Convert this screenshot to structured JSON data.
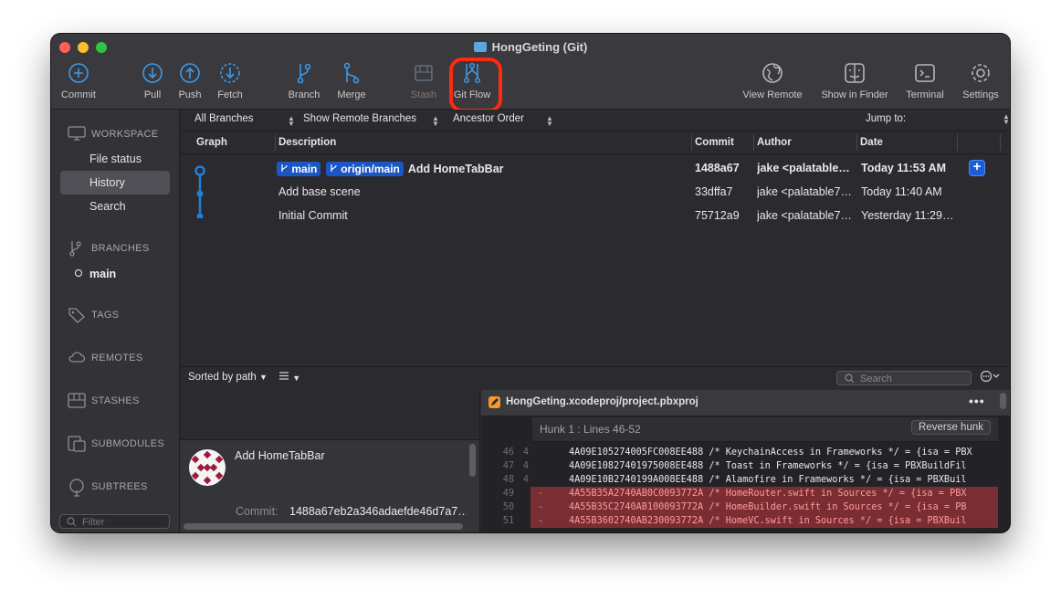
{
  "window": {
    "title": "HongGeting (Git)"
  },
  "toolbar": {
    "commit": "Commit",
    "pull": "Pull",
    "push": "Push",
    "fetch": "Fetch",
    "branch": "Branch",
    "merge": "Merge",
    "stash": "Stash",
    "git_flow": "Git Flow",
    "view_remote": "View Remote",
    "show_in_finder": "Show in Finder",
    "terminal": "Terminal",
    "settings": "Settings"
  },
  "sidebar": {
    "workspace": "WORKSPACE",
    "file_status": "File status",
    "history": "History",
    "search": "Search",
    "branches": "BRANCHES",
    "current_branch": "main",
    "tags": "TAGS",
    "remotes": "REMOTES",
    "stashes": "STASHES",
    "submodules": "SUBMODULES",
    "subtrees": "SUBTREES",
    "filter_placeholder": "Filter"
  },
  "filterbar": {
    "branches": "All Branches",
    "remote": "Show Remote Branches",
    "order": "Ancestor Order",
    "jump_to": "Jump to:"
  },
  "columns": {
    "graph": "Graph",
    "description": "Description",
    "commit": "Commit",
    "author": "Author",
    "date": "Date"
  },
  "commits": [
    {
      "tags": [
        "main",
        "origin/main"
      ],
      "description": "Add HomeTabBar",
      "hash": "1488a67",
      "author": "jake <palatable…",
      "date": "Today 11:53 AM"
    },
    {
      "tags": [],
      "description": "Add base scene",
      "hash": "33dffa7",
      "author": "jake <palatable7…",
      "date": "Today 11:40 AM"
    },
    {
      "tags": [],
      "description": "Initial Commit",
      "hash": "75712a9",
      "author": "jake <palatable7…",
      "date": "Yesterday 11:29…"
    }
  ],
  "lower": {
    "sort": "Sorted by path",
    "search_placeholder": "Search"
  },
  "commit_detail": {
    "title": "Add HomeTabBar",
    "commit_label": "Commit:",
    "commit_hash": "1488a67eb2a346adaefde46d7a7…"
  },
  "diff": {
    "file": "HongGeting.xcodeproj/project.pbxproj",
    "hunk": "Hunk 1 : Lines 46-52",
    "reverse": "Reverse hunk",
    "lines": [
      {
        "old": "46",
        "new": "4",
        "mark": "",
        "code": "4A09E105274005FC008EE488 /* KeychainAccess in Frameworks */ = {isa = PBX"
      },
      {
        "old": "47",
        "new": "4",
        "mark": "",
        "code": "4A09E10827401975008EE488 /* Toast in Frameworks */ = {isa = PBXBuildFil"
      },
      {
        "old": "48",
        "new": "4",
        "mark": "",
        "code": "4A09E10B2740199A008EE488 /* Alamofire in Frameworks */ = {isa = PBXBuil"
      },
      {
        "old": "49",
        "new": "",
        "mark": "-",
        "code": "4A55B35A2740AB0C0093772A /* HomeRouter.swift in Sources */ = {isa = PBX"
      },
      {
        "old": "50",
        "new": "",
        "mark": "-",
        "code": "4A55B35C2740AB100093772A /* HomeBuilder.swift in Sources */ = {isa = PB"
      },
      {
        "old": "51",
        "new": "",
        "mark": "-",
        "code": "4A55B3602740AB230093772A /* HomeVC.swift in Sources */ = {isa = PBXBuil"
      }
    ]
  },
  "colors": {
    "accent": "#1c55c4",
    "highlight_ring": "#ff2a10",
    "deleted_line": "#7a2e33"
  }
}
